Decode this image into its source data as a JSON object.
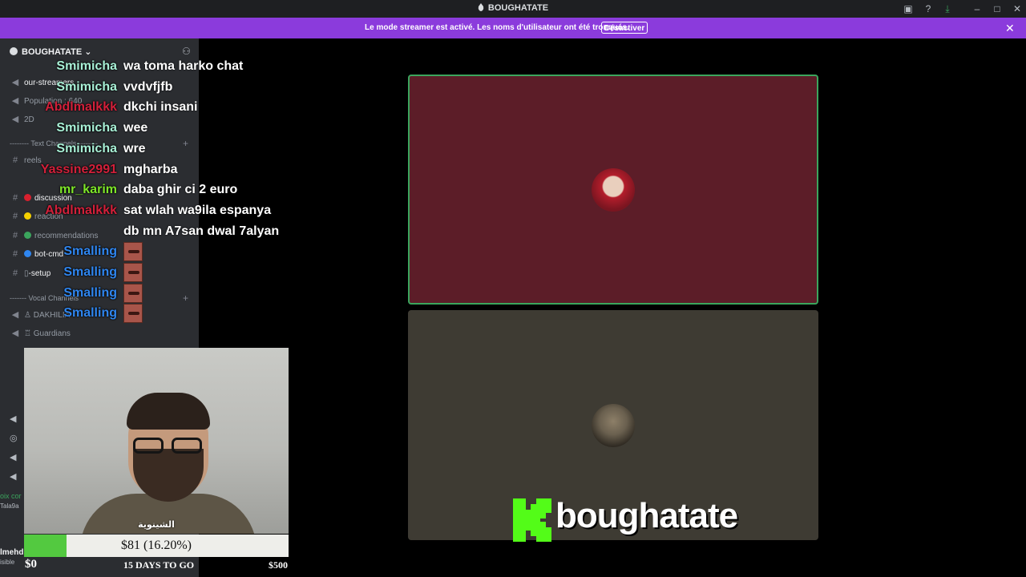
{
  "window": {
    "title": "BOUGHATATE"
  },
  "banner": {
    "message": "Le mode streamer est activé. Les noms d'utilisateur ont été tronqués.",
    "button": "Désactiver"
  },
  "sidebar": {
    "server_name": "BOUGHATATE",
    "channels": [
      {
        "label": "our-streamers"
      },
      {
        "label": "Population : 640"
      },
      {
        "label": "2D"
      },
      {
        "label": "reels"
      },
      {
        "label": "discussion"
      },
      {
        "label": "reaction"
      },
      {
        "label": "recommendations"
      },
      {
        "label": "bot-cmd"
      },
      {
        "label": "-setup"
      },
      {
        "label": "DAKHILIA"
      },
      {
        "label": "Guardians"
      }
    ],
    "categories": {
      "text": "-------- Text Channels --------",
      "voice": "------- Vocal Channels"
    }
  },
  "chat": [
    {
      "user": "Smimicha",
      "color": "#a8f0d6",
      "text": "wa toma harko chat"
    },
    {
      "user": "Smimicha",
      "color": "#a8f0d6",
      "text": "vvdvfjfb"
    },
    {
      "user": "Abdlmalkkk",
      "color": "#d2203a",
      "text": "dkchi insani"
    },
    {
      "user": "Smimicha",
      "color": "#a8f0d6",
      "text": "wee"
    },
    {
      "user": "Smimicha",
      "color": "#a8f0d6",
      "text": "wre"
    },
    {
      "user": "Yassine2991",
      "color": "#d2203a",
      "text": "mgharba"
    },
    {
      "user": "mr_karim",
      "color": "#7ee629",
      "text": "daba ghir ci 2 euro"
    },
    {
      "user": "Abdlmalkkk",
      "color": "#d2203a",
      "text": "sat wlah wa9ila espanya"
    },
    {
      "user": "",
      "color": "#d2203a",
      "text": "db mn A7san dwal 7alyan"
    },
    {
      "user": "Smalling",
      "color": "#2f86f0",
      "text": ""
    },
    {
      "user": "Smalling",
      "color": "#2f86f0",
      "text": ""
    },
    {
      "user": "Smalling",
      "color": "#2f86f0",
      "text": ""
    },
    {
      "user": "Smalling",
      "color": "#2f86f0",
      "text": ""
    }
  ],
  "webcam": {
    "caption": "الشينوية"
  },
  "goal": {
    "label": "$81 (16.20%)",
    "progress_pct": 16.2,
    "min": "$0",
    "days": "15 DAYS TO GO",
    "max": "$500"
  },
  "left_fragments": {
    "line1": "oix cor",
    "line2": "Tala9a",
    "line3": "lmehd",
    "line4": "isible"
  },
  "overlay": {
    "channel_name": "boughatate"
  },
  "colors": {
    "banner": "#8b3bdc",
    "speaking": "#3ba55d",
    "kick_green": "#53fc18"
  }
}
